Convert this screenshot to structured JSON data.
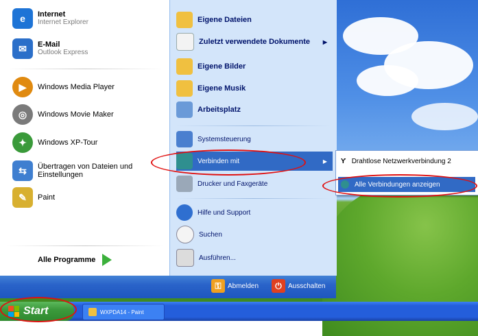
{
  "left_items": [
    {
      "title": "Internet",
      "sub": "Internet Explorer",
      "icon": "internet-explorer-icon",
      "color": "#1e74d6"
    },
    {
      "title": "E-Mail",
      "sub": "Outlook Express",
      "icon": "outlook-express-icon",
      "color": "#2b6fc9"
    },
    {
      "title": "Windows Media Player",
      "icon": "media-player-icon",
      "color": "#e08a10"
    },
    {
      "title": "Windows Movie Maker",
      "icon": "movie-maker-icon",
      "color": "#7a7a7a"
    },
    {
      "title": "Windows XP-Tour",
      "icon": "xp-tour-icon",
      "color": "#3a9a3a"
    },
    {
      "title": "Übertragen von Dateien und Einstellungen",
      "icon": "transfer-wizard-icon",
      "color": "#3f7fd0"
    },
    {
      "title": "Paint",
      "icon": "paint-icon",
      "color": "#d8b030"
    }
  ],
  "all_programs": "Alle Programme",
  "right_items": [
    {
      "label": "Eigene Dateien",
      "icon": "my-documents-icon",
      "color": "#f0c040"
    },
    {
      "label": "Zuletzt verwendete Dokumente",
      "icon": "recent-documents-icon",
      "color": "#f3f3f3"
    },
    {
      "label": "Eigene Bilder",
      "icon": "my-pictures-icon",
      "color": "#f0c040"
    },
    {
      "label": "Eigene Musik",
      "icon": "my-music-icon",
      "color": "#f0c040"
    },
    {
      "label": "Arbeitsplatz",
      "icon": "my-computer-icon",
      "color": "#6a9ad8"
    },
    {
      "label": "Systemsteuerung",
      "icon": "control-panel-icon",
      "color": "#4a7fcf"
    },
    {
      "label": "Verbinden mit",
      "icon": "connect-to-icon",
      "color": "#2f8f8f"
    },
    {
      "label": "Drucker und Faxgeräte",
      "icon": "printers-icon",
      "color": "#9aa8b8"
    },
    {
      "label": "Hilfe und Support",
      "icon": "help-icon",
      "color": "#2f6fd0"
    },
    {
      "label": "Suchen",
      "icon": "search-icon",
      "color": "#f4f4f4"
    },
    {
      "label": "Ausführen...",
      "icon": "run-icon",
      "color": "#dcdcdc"
    }
  ],
  "submenu": [
    {
      "label": "Drahtlose Netzwerkverbindung 2",
      "icon": "wireless-icon"
    },
    {
      "label": "Alle Verbindungen anzeigen",
      "icon": "connections-icon"
    }
  ],
  "footer": {
    "logoff": "Abmelden",
    "shutdown": "Ausschalten"
  },
  "taskbar": {
    "start": "Start",
    "task": "WXPDA14 - Paint"
  }
}
